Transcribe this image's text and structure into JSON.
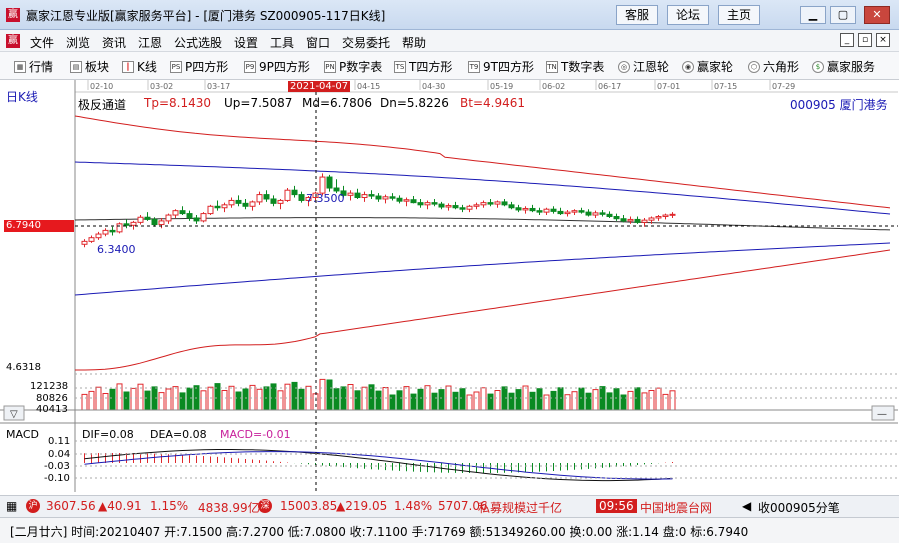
{
  "window": {
    "title": "赢家江恩专业版[赢家服务平台] - [厦门港务  SZ000905-117日K线]",
    "links": [
      "客服",
      "论坛",
      "主页"
    ]
  },
  "menu": {
    "items": [
      "文件",
      "浏览",
      "资讯",
      "江恩",
      "公式选股",
      "设置",
      "工具",
      "窗口",
      "交易委托",
      "帮助"
    ]
  },
  "toolbar": {
    "items": [
      {
        "label": "行情",
        "icon": "grid-icon"
      },
      {
        "label": "板块",
        "icon": "blocks-icon"
      },
      {
        "label": "K线",
        "icon": "candlestick-icon"
      },
      {
        "label": "P四方形",
        "icon": "p-square-icon"
      },
      {
        "label": "9P四方形",
        "icon": "9p-square-icon"
      },
      {
        "label": "P数字表",
        "icon": "p-table-icon"
      },
      {
        "label": "T四方形",
        "icon": "t-square-icon"
      },
      {
        "label": "9T四方形",
        "icon": "9t-square-icon"
      },
      {
        "label": "T数字表",
        "icon": "t-table-icon"
      },
      {
        "label": "江恩轮",
        "icon": "gann-wheel-icon"
      },
      {
        "label": "赢家轮",
        "icon": "winner-wheel-icon"
      },
      {
        "label": "六角形",
        "icon": "hexagon-icon"
      },
      {
        "label": "赢家服务",
        "icon": "dollar-icon"
      }
    ]
  },
  "chart": {
    "period_label": "日K线",
    "indicator_name": "极反通道",
    "params": {
      "tp": "Tp=8.1430",
      "up": "Up=7.5087",
      "md": "Md=6.7806",
      "dn": "Dn=5.8226",
      "bt": "Bt=4.9461"
    },
    "stock_label": "000905  厦门港务",
    "date_ticks": [
      "02-10",
      "03-02",
      "03-17",
      "04-15",
      "04-30",
      "05-19",
      "06-02",
      "06-17",
      "07-01",
      "07-15",
      "07-29"
    ],
    "cursor_date": "2021-04-07",
    "current_price_tag": "6.7940",
    "annotations": {
      "high": "7.3500",
      "low": "6.3400"
    },
    "volume_axis": [
      "121238",
      "80826",
      "40413"
    ],
    "volume_top_label": "4.6318",
    "macd": {
      "title": "MACD",
      "dif": "DIF=0.08",
      "dea": "DEA=0.08",
      "macd": "MACD=-0.01",
      "axis": [
        "0.11",
        "0.04",
        "-0.03",
        "-0.10"
      ]
    },
    "colors": {
      "up": "#e0282c",
      "down": "#0a8a22",
      "upper_band": "#d21e1e",
      "mid_band": "#1a1ab4"
    }
  },
  "status": {
    "sh": {
      "code": "沪",
      "value": "3607.56",
      "change": "▲40.91",
      "pct": "1.15%",
      "amount": "4838.99亿"
    },
    "sz": {
      "code": "深",
      "value": "15003.85",
      "change": "▲219.05",
      "pct": "1.48%",
      "amount": "5707.06"
    },
    "news": "私募规模过千亿",
    "time": "09:56",
    "site": "中国地震台网",
    "collect": "收000905分笔"
  },
  "footer": {
    "text": "[二月廿六] 时间:20210407 开:7.1500 高:7.2700 低:7.0800 收:7.1100 手:71769 额:51349260.00 换:0.00 涨:1.14 盘:0 标:6.7940"
  },
  "chart_data": {
    "type": "candlestick",
    "bars": 117,
    "candles_ohlc": [
      [
        6.38,
        6.45,
        6.34,
        6.42
      ],
      [
        6.42,
        6.5,
        6.4,
        6.47
      ],
      [
        6.47,
        6.55,
        6.44,
        6.52
      ],
      [
        6.52,
        6.6,
        6.49,
        6.57
      ],
      [
        6.57,
        6.62,
        6.5,
        6.55
      ],
      [
        6.55,
        6.68,
        6.53,
        6.66
      ],
      [
        6.66,
        6.72,
        6.6,
        6.64
      ],
      [
        6.64,
        6.7,
        6.58,
        6.68
      ],
      [
        6.68,
        6.78,
        6.65,
        6.75
      ],
      [
        6.75,
        6.82,
        6.7,
        6.72
      ],
      [
        6.72,
        6.75,
        6.62,
        6.65
      ],
      [
        6.65,
        6.74,
        6.6,
        6.7
      ],
      [
        6.7,
        6.8,
        6.66,
        6.78
      ],
      [
        6.78,
        6.86,
        6.74,
        6.84
      ],
      [
        6.84,
        6.9,
        6.78,
        6.8
      ],
      [
        6.8,
        6.84,
        6.7,
        6.74
      ],
      [
        6.74,
        6.78,
        6.66,
        6.7
      ],
      [
        6.7,
        6.82,
        6.68,
        6.8
      ],
      [
        6.8,
        6.92,
        6.78,
        6.9
      ],
      [
        6.9,
        6.98,
        6.84,
        6.88
      ],
      [
        6.88,
        6.95,
        6.82,
        6.92
      ],
      [
        6.92,
        7.02,
        6.88,
        6.98
      ],
      [
        6.98,
        7.05,
        6.9,
        6.94
      ],
      [
        6.94,
        7.0,
        6.86,
        6.9
      ],
      [
        6.9,
        6.98,
        6.84,
        6.96
      ],
      [
        6.96,
        7.1,
        6.92,
        7.06
      ],
      [
        7.06,
        7.12,
        6.96,
        7.0
      ],
      [
        7.0,
        7.05,
        6.9,
        6.94
      ],
      [
        6.94,
        7.0,
        6.86,
        6.98
      ],
      [
        6.98,
        7.15,
        6.96,
        7.12
      ],
      [
        7.12,
        7.18,
        7.02,
        7.06
      ],
      [
        7.06,
        7.1,
        6.95,
        6.98
      ],
      [
        6.98,
        7.04,
        6.9,
        7.02
      ],
      [
        7.02,
        7.1,
        6.98,
        7.08
      ],
      [
        7.08,
        7.35,
        7.05,
        7.3
      ],
      [
        7.3,
        7.33,
        7.1,
        7.15
      ],
      [
        7.15,
        7.27,
        7.08,
        7.11
      ],
      [
        7.11,
        7.18,
        7.02,
        7.05
      ],
      [
        7.05,
        7.12,
        6.98,
        7.08
      ],
      [
        7.08,
        7.14,
        7.0,
        7.02
      ],
      [
        7.02,
        7.1,
        6.96,
        7.06
      ],
      [
        7.06,
        7.12,
        7.0,
        7.04
      ],
      [
        7.04,
        7.08,
        6.96,
        7.0
      ],
      [
        7.0,
        7.06,
        6.94,
        7.03
      ],
      [
        7.03,
        7.08,
        6.98,
        7.01
      ],
      [
        7.01,
        7.05,
        6.94,
        6.97
      ],
      [
        6.97,
        7.02,
        6.9,
        6.99
      ],
      [
        6.99,
        7.04,
        6.94,
        6.95
      ],
      [
        6.95,
        7.0,
        6.88,
        6.92
      ],
      [
        6.92,
        6.98,
        6.86,
        6.95
      ],
      [
        6.95,
        7.0,
        6.9,
        6.93
      ],
      [
        6.93,
        6.96,
        6.86,
        6.89
      ],
      [
        6.89,
        6.94,
        6.84,
        6.91
      ],
      [
        6.91,
        6.96,
        6.86,
        6.88
      ],
      [
        6.88,
        6.92,
        6.82,
        6.86
      ],
      [
        6.86,
        6.92,
        6.82,
        6.9
      ],
      [
        6.9,
        6.95,
        6.86,
        6.92
      ],
      [
        6.92,
        6.98,
        6.88,
        6.95
      ],
      [
        6.95,
        7.0,
        6.9,
        6.93
      ],
      [
        6.93,
        6.98,
        6.88,
        6.96
      ],
      [
        6.96,
        7.0,
        6.9,
        6.92
      ],
      [
        6.92,
        6.96,
        6.86,
        6.88
      ],
      [
        6.88,
        6.92,
        6.82,
        6.85
      ],
      [
        6.85,
        6.9,
        6.8,
        6.87
      ],
      [
        6.87,
        6.92,
        6.82,
        6.84
      ],
      [
        6.84,
        6.88,
        6.78,
        6.82
      ],
      [
        6.82,
        6.88,
        6.78,
        6.86
      ],
      [
        6.86,
        6.9,
        6.8,
        6.83
      ],
      [
        6.83,
        6.88,
        6.78,
        6.8
      ],
      [
        6.8,
        6.85,
        6.76,
        6.82
      ],
      [
        6.82,
        6.86,
        6.78,
        6.84
      ],
      [
        6.84,
        6.88,
        6.8,
        6.82
      ],
      [
        6.82,
        6.86,
        6.76,
        6.78
      ],
      [
        6.78,
        6.84,
        6.74,
        6.81
      ],
      [
        6.81,
        6.85,
        6.76,
        6.79
      ],
      [
        6.79,
        6.83,
        6.74,
        6.76
      ],
      [
        6.76,
        6.8,
        6.7,
        6.73
      ],
      [
        6.73,
        6.78,
        6.68,
        6.7
      ],
      [
        6.7,
        6.76,
        6.66,
        6.72
      ],
      [
        6.72,
        6.76,
        6.66,
        6.68
      ],
      [
        6.68,
        6.74,
        6.62,
        6.71
      ],
      [
        6.71,
        6.76,
        6.66,
        6.74
      ],
      [
        6.74,
        6.78,
        6.7,
        6.76
      ],
      [
        6.76,
        6.8,
        6.72,
        6.78
      ],
      [
        6.78,
        6.82,
        6.74,
        6.79
      ]
    ],
    "price_range": [
      4.6318,
      8.3
    ],
    "upper_band_Tp": 8.143,
    "upper_band_Up": 7.5087,
    "mid_band_Md": 6.7806,
    "lower_band_Dn": 5.8226,
    "lower_band_Bt": 4.9461,
    "volume_range": [
      0,
      121238
    ]
  }
}
